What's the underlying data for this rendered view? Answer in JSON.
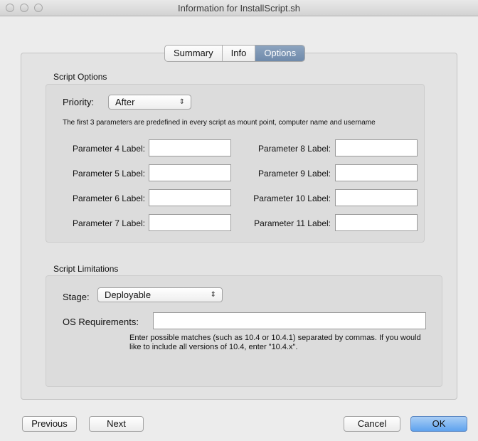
{
  "window": {
    "title": "Information for InstallScript.sh"
  },
  "tabs": [
    {
      "label": "Summary",
      "active": false
    },
    {
      "label": "Info",
      "active": false
    },
    {
      "label": "Options",
      "active": true
    }
  ],
  "script_options": {
    "group_label": "Script Options",
    "priority_label": "Priority:",
    "priority_value": "After",
    "note": "The first 3 parameters are predefined in every script as mount point, computer name and username",
    "parameters_left": [
      {
        "label": "Parameter 4 Label:",
        "value": ""
      },
      {
        "label": "Parameter 5 Label:",
        "value": ""
      },
      {
        "label": "Parameter 6 Label:",
        "value": ""
      },
      {
        "label": "Parameter 7 Label:",
        "value": ""
      }
    ],
    "parameters_right": [
      {
        "label": "Parameter 8 Label:",
        "value": ""
      },
      {
        "label": "Parameter 9 Label:",
        "value": ""
      },
      {
        "label": "Parameter 10 Label:",
        "value": ""
      },
      {
        "label": "Parameter 11 Label:",
        "value": ""
      }
    ]
  },
  "script_limitations": {
    "group_label": "Script Limitations",
    "stage_label": "Stage:",
    "stage_value": "Deployable",
    "os_label": "OS Requirements:",
    "os_value": "",
    "help_text": "Enter possible matches (such as 10.4 or 10.4.1) separated by commas. If you would like to include all versions of 10.4, enter \"10.4.x\"."
  },
  "buttons": {
    "previous": "Previous",
    "next": "Next",
    "cancel": "Cancel",
    "ok": "OK"
  },
  "icons": {
    "popup_arrows": "⇕",
    "traffic_light": "window-control"
  }
}
